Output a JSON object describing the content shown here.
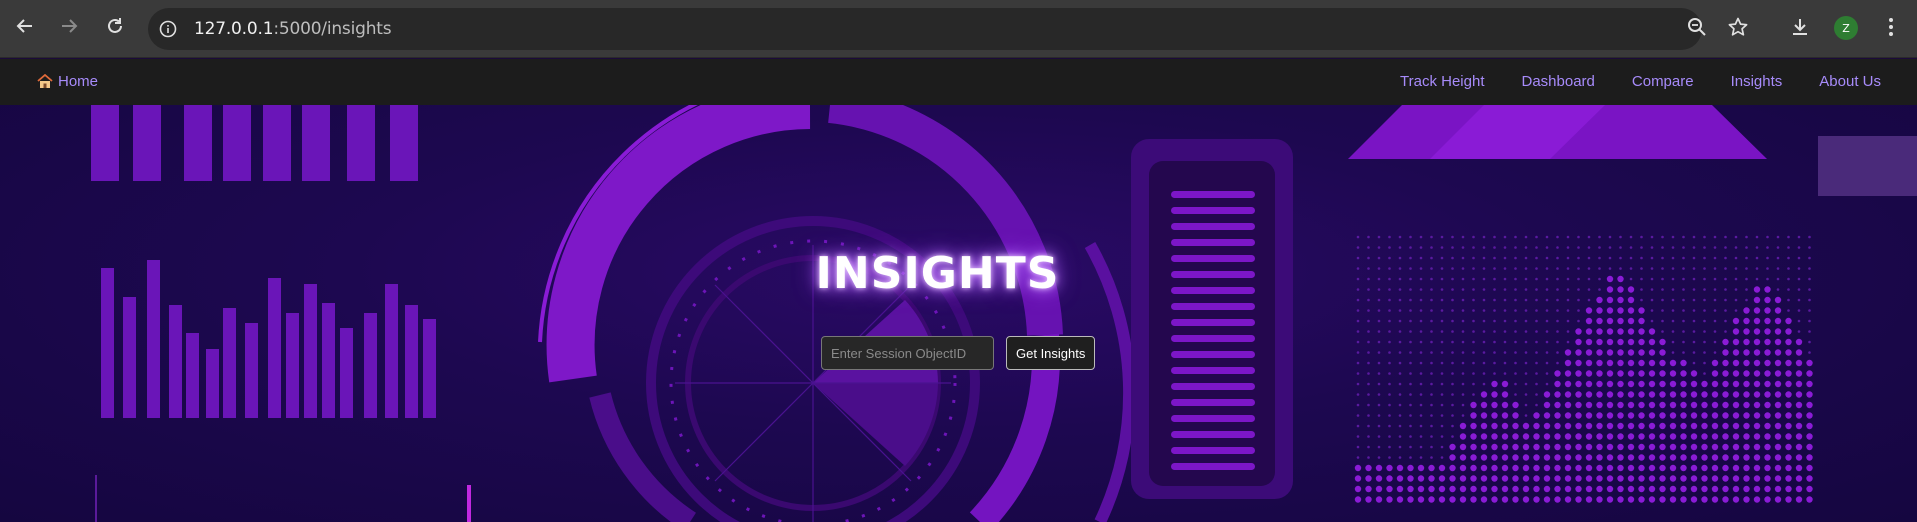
{
  "browser": {
    "url_host": "127.0.0.1",
    "url_path": ":5000/insights",
    "profile_initial": "Z"
  },
  "navbar": {
    "home_label": "Home",
    "links": [
      "Track Height",
      "Dashboard",
      "Compare",
      "Insights",
      "About Us"
    ]
  },
  "page": {
    "title": "INSIGHTS",
    "session_input_placeholder": "Enter Session ObjectID",
    "session_input_value": "",
    "submit_label": "Get Insights"
  },
  "colors": {
    "accent": "#a78bfa",
    "hero_bg": "#1d0850",
    "decor_purple": "#7a14c4"
  }
}
